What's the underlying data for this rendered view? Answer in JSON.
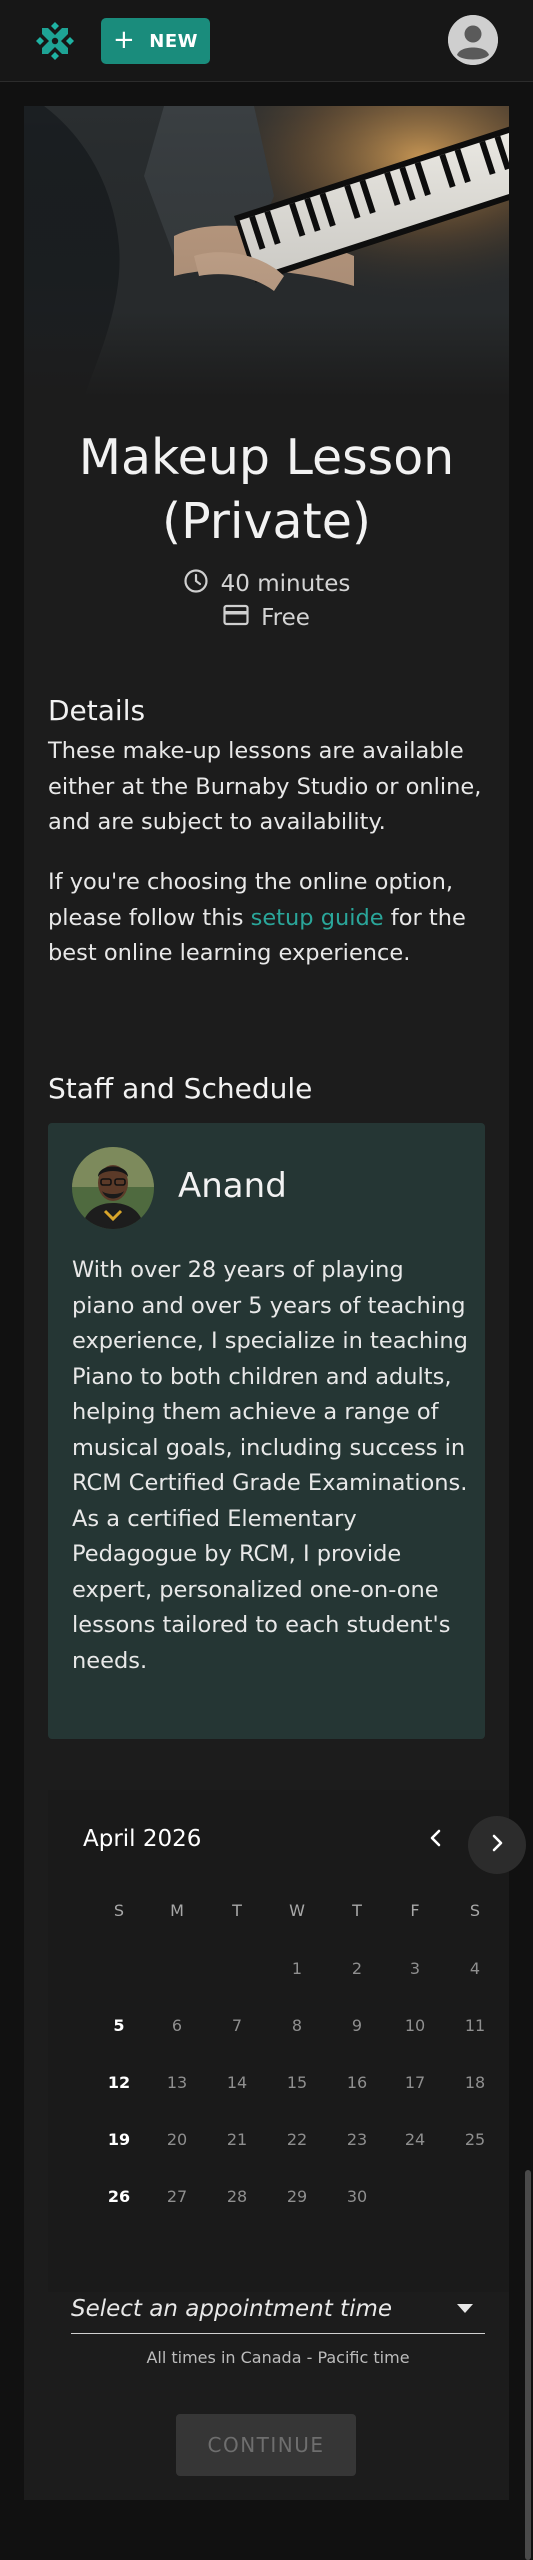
{
  "header": {
    "new_label": "NEW",
    "brand_color": "#1a8c7c"
  },
  "service": {
    "title_line1": "Makeup Lesson",
    "title_line2": "(Private)",
    "duration": "40 minutes",
    "price": "Free"
  },
  "details": {
    "heading": "Details",
    "para1": "These make-up lessons are available either at the Burnaby Studio or online, and are subject to availability.",
    "para2_before": "If you're choosing the online option, please follow this ",
    "para2_link": "setup guide",
    "para2_after": " for the best online learning experience."
  },
  "staff": {
    "heading": "Staff and Schedule",
    "name": "Anand",
    "bio": "With over 28 years of playing piano and over 5 years of teaching experience, I specialize in teaching Piano to both children and adults, helping them achieve a range of musical goals, including success in RCM Certified Grade Examinations. As a certified Elementary Pedagogue by RCM, I provide expert, personalized one-on-one lessons tailored to each student's needs."
  },
  "calendar": {
    "month": "April 2026",
    "weekdays": [
      "S",
      "M",
      "T",
      "W",
      "T",
      "F",
      "S"
    ],
    "weeks": [
      [
        "",
        "",
        "",
        "1",
        "2",
        "3",
        "4"
      ],
      [
        "5",
        "6",
        "7",
        "8",
        "9",
        "10",
        "11"
      ],
      [
        "12",
        "13",
        "14",
        "15",
        "16",
        "17",
        "18"
      ],
      [
        "19",
        "20",
        "21",
        "22",
        "23",
        "24",
        "25"
      ],
      [
        "26",
        "27",
        "28",
        "29",
        "30",
        "",
        ""
      ]
    ],
    "emphasized_days": [
      "5",
      "12",
      "19",
      "26"
    ]
  },
  "booking": {
    "select_placeholder": "Select an appointment time",
    "timezone_note": "All times in Canada - Pacific time",
    "continue_label": "CONTINUE"
  }
}
